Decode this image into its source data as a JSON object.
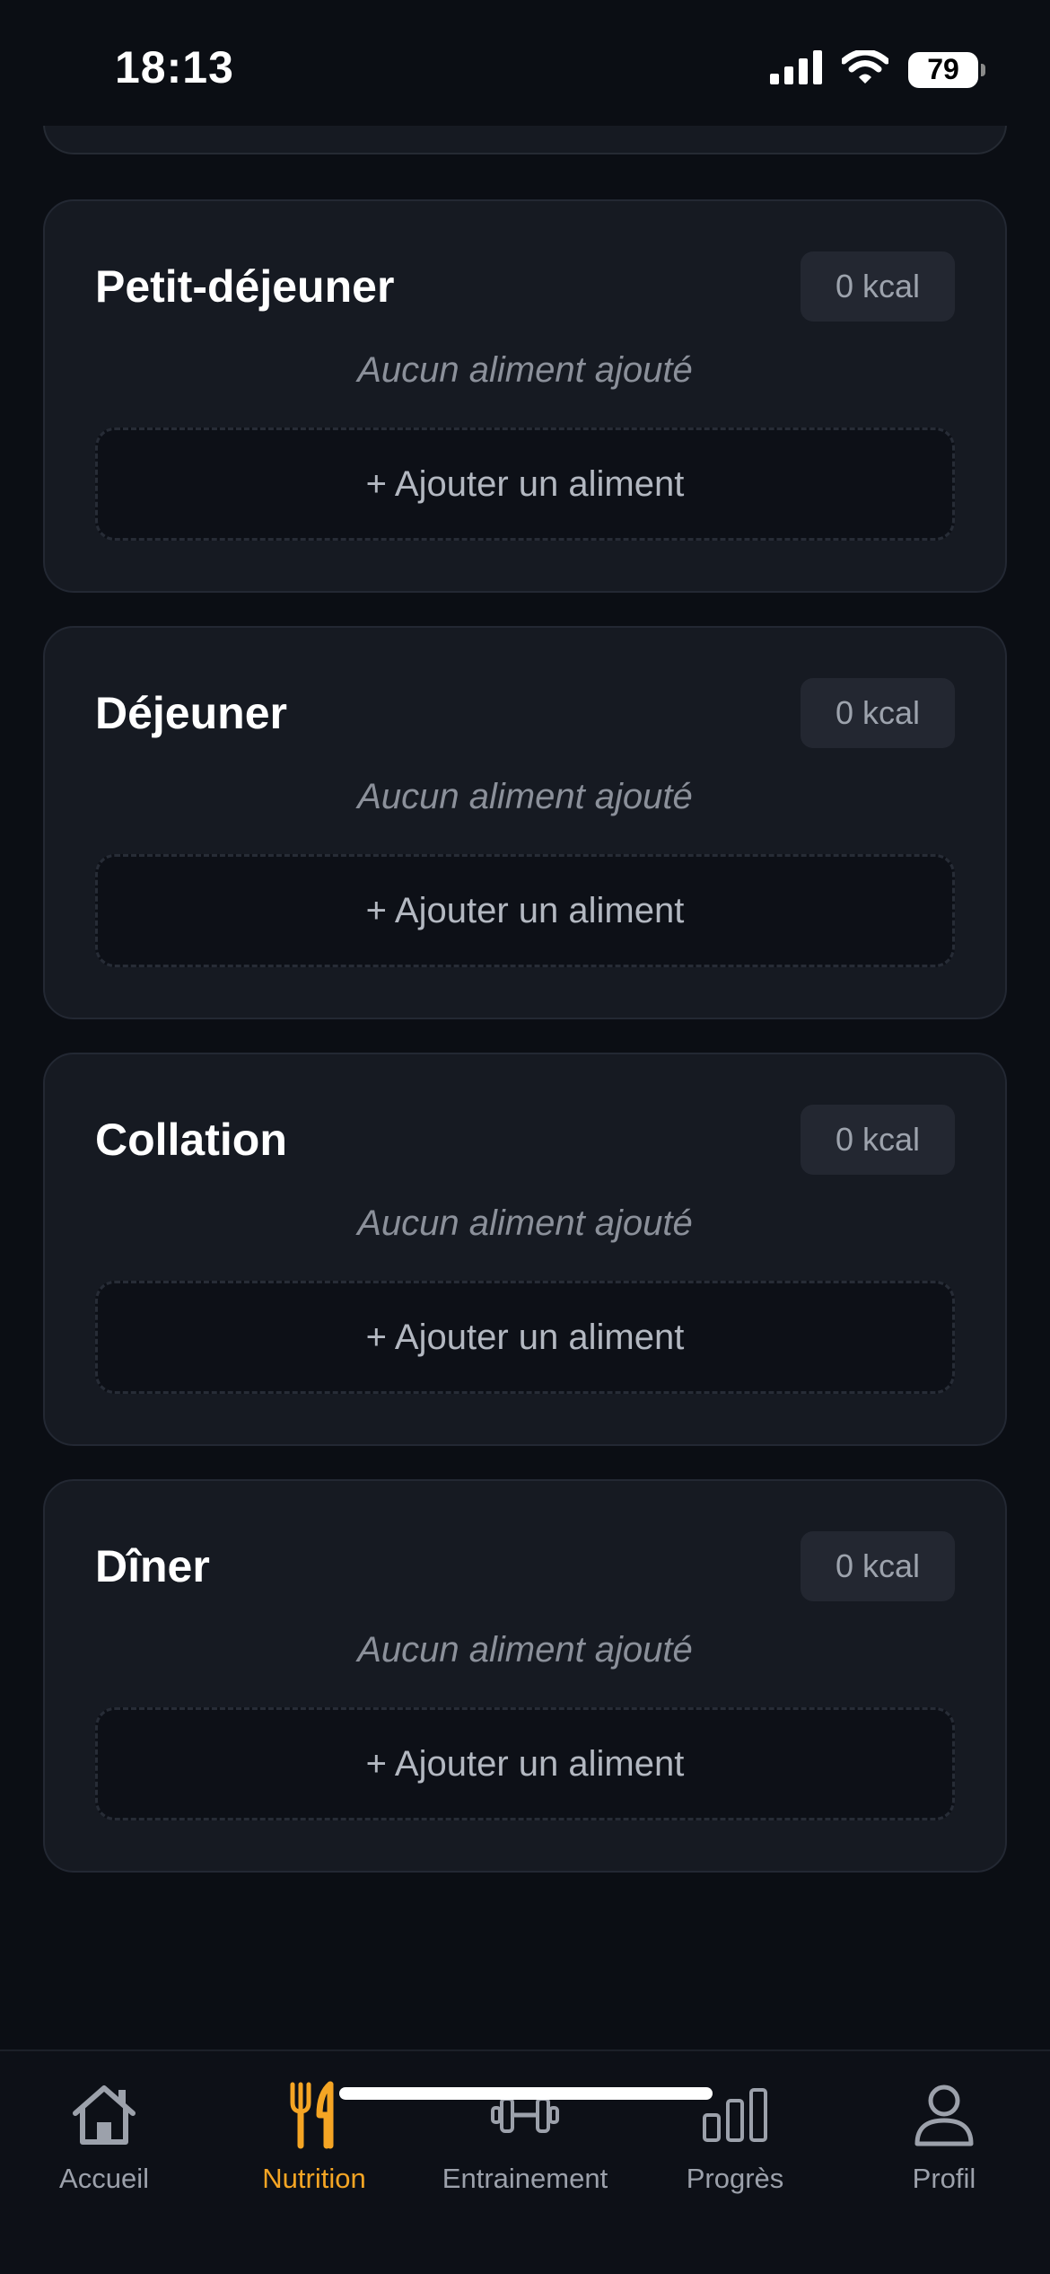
{
  "status_bar": {
    "time": "18:13",
    "battery": "79"
  },
  "meals": [
    {
      "title": "Petit-déjeuner",
      "kcal": "0 kcal",
      "empty": "Aucun aliment ajouté",
      "add_label": "+ Ajouter un aliment"
    },
    {
      "title": "Déjeuner",
      "kcal": "0 kcal",
      "empty": "Aucun aliment ajouté",
      "add_label": "+ Ajouter un aliment"
    },
    {
      "title": "Collation",
      "kcal": "0 kcal",
      "empty": "Aucun aliment ajouté",
      "add_label": "+ Ajouter un aliment"
    },
    {
      "title": "Dîner",
      "kcal": "0 kcal",
      "empty": "Aucun aliment ajouté",
      "add_label": "+ Ajouter un aliment"
    }
  ],
  "tab_bar": {
    "active": "Nutrition",
    "accent_color": "#f5a524",
    "items": [
      {
        "label": "Accueil",
        "icon": "home-icon"
      },
      {
        "label": "Nutrition",
        "icon": "fork-knife-icon"
      },
      {
        "label": "Entrainement",
        "icon": "dumbbell-icon"
      },
      {
        "label": "Progrès",
        "icon": "bar-chart-icon"
      },
      {
        "label": "Profil",
        "icon": "person-icon"
      }
    ]
  }
}
